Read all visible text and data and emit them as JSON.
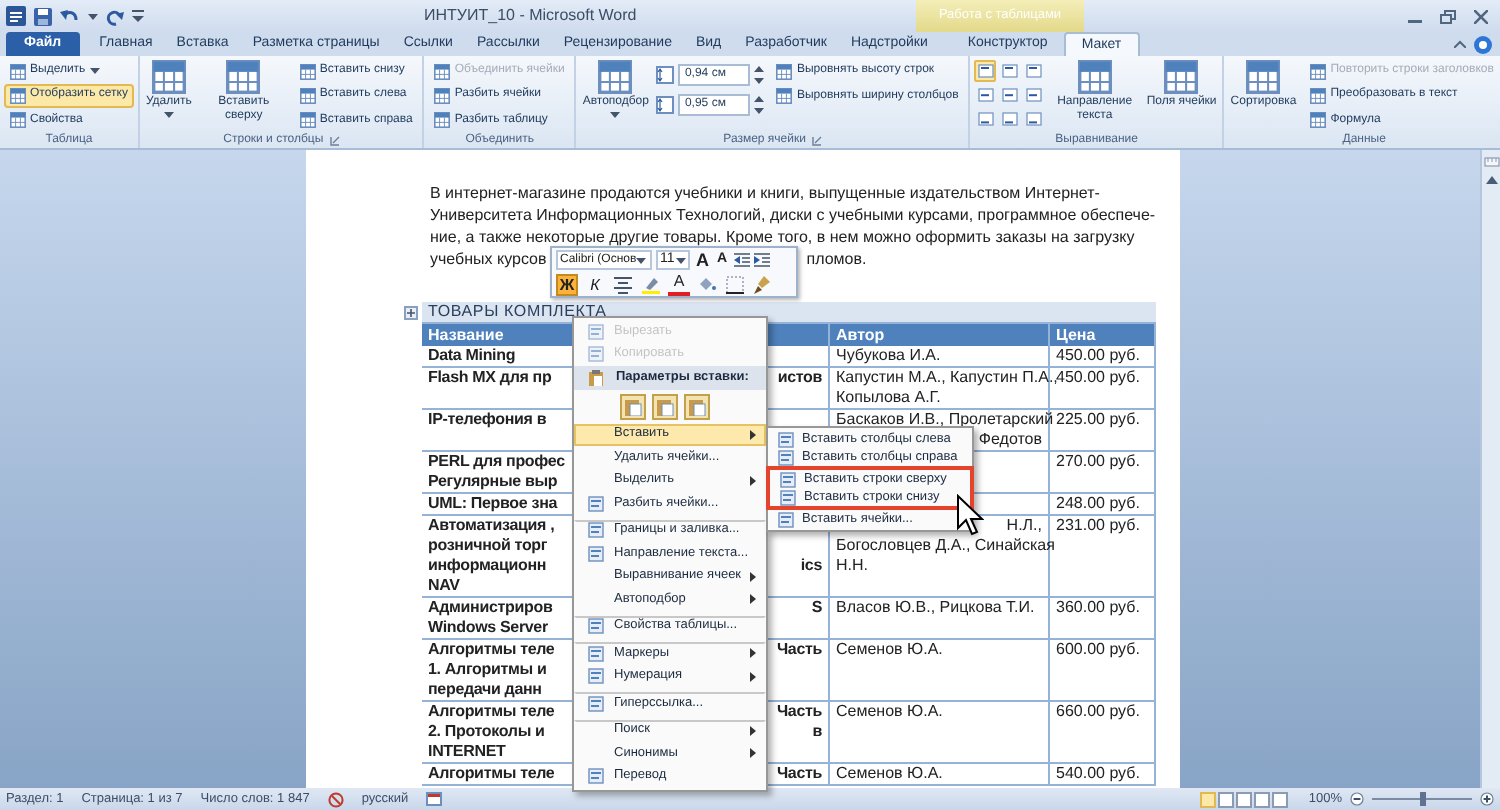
{
  "title_bar": {
    "title": "ИНТУИТ_10 - Microsoft Word",
    "contextual_group": "Работа с таблицами"
  },
  "tabs": [
    {
      "label": "Файл",
      "kind": "file",
      "selected": false
    },
    {
      "label": "Главная",
      "kind": "normal",
      "selected": false
    },
    {
      "label": "Вставка",
      "kind": "normal",
      "selected": false
    },
    {
      "label": "Разметка страницы",
      "kind": "normal",
      "selected": false
    },
    {
      "label": "Ссылки",
      "kind": "normal",
      "selected": false
    },
    {
      "label": "Рассылки",
      "kind": "normal",
      "selected": false
    },
    {
      "label": "Рецензирование",
      "kind": "normal",
      "selected": false
    },
    {
      "label": "Вид",
      "kind": "normal",
      "selected": false
    },
    {
      "label": "Разработчик",
      "kind": "normal",
      "selected": false
    },
    {
      "label": "Надстройки",
      "kind": "normal",
      "selected": false
    },
    {
      "label": "Конструктор",
      "kind": "contextual",
      "selected": false
    },
    {
      "label": "Макет",
      "kind": "contextual",
      "selected": true
    }
  ],
  "ribbon": [
    {
      "label": "Таблица",
      "launcher": false,
      "columns": [
        [
          {
            "kind": "small",
            "label": "Выделить",
            "dropdown": true,
            "on": false,
            "disabled": false
          },
          {
            "kind": "small",
            "label": "Отобразить сетку",
            "dropdown": false,
            "on": true,
            "disabled": false
          },
          {
            "kind": "small",
            "label": "Свойства",
            "dropdown": false,
            "on": false,
            "disabled": false
          }
        ]
      ]
    },
    {
      "label": "Строки и столбцы",
      "launcher": true,
      "columns": [
        [
          {
            "kind": "big",
            "label": "Удалить",
            "dropdown": true,
            "on": false,
            "disabled": false
          }
        ],
        [
          {
            "kind": "big",
            "label": "Вставить сверху",
            "dropdown": false,
            "on": false,
            "disabled": false
          }
        ],
        [
          {
            "kind": "small",
            "label": "Вставить снизу",
            "dropdown": false,
            "on": false,
            "disabled": false
          },
          {
            "kind": "small",
            "label": "Вставить слева",
            "dropdown": false,
            "on": false,
            "disabled": false
          },
          {
            "kind": "small",
            "label": "Вставить справа",
            "dropdown": false,
            "on": false,
            "disabled": false
          }
        ]
      ]
    },
    {
      "label": "Объединить",
      "launcher": false,
      "columns": [
        [
          {
            "kind": "small",
            "label": "Объединить ячейки",
            "dropdown": false,
            "on": false,
            "disabled": true
          },
          {
            "kind": "small",
            "label": "Разбить ячейки",
            "dropdown": false,
            "on": false,
            "disabled": false
          },
          {
            "kind": "small",
            "label": "Разбить таблицу",
            "dropdown": false,
            "on": false,
            "disabled": false
          }
        ]
      ]
    },
    {
      "label": "Размер ячейки",
      "launcher": true,
      "columns": [
        [
          {
            "kind": "big",
            "label": "Автоподбор",
            "dropdown": true,
            "on": false,
            "disabled": false
          }
        ],
        [
          {
            "kind": "spin",
            "value": "0,94 см"
          },
          {
            "kind": "spin",
            "value": "0,95 см"
          }
        ],
        [
          {
            "kind": "small",
            "label": "Выровнять высоту строк",
            "dropdown": false,
            "on": false,
            "disabled": false
          },
          {
            "kind": "small",
            "label": "Выровнять ширину столбцов",
            "dropdown": false,
            "on": false,
            "disabled": false
          }
        ]
      ]
    },
    {
      "label": "Выравнивание",
      "launcher": false,
      "columns": [
        [
          {
            "kind": "align_grid",
            "cells": [
              {
                "selected": true
              },
              {
                "selected": false
              },
              {
                "selected": false
              },
              {
                "selected": false
              },
              {
                "selected": false
              },
              {
                "selected": false
              },
              {
                "selected": false
              },
              {
                "selected": false
              },
              {
                "selected": false
              }
            ]
          }
        ],
        [
          {
            "kind": "big",
            "label": "Направление текста",
            "dropdown": false,
            "on": false,
            "disabled": false
          }
        ],
        [
          {
            "kind": "big",
            "label": "Поля ячейки",
            "dropdown": false,
            "on": false,
            "disabled": false
          }
        ]
      ]
    },
    {
      "label": "Данные",
      "launcher": false,
      "columns": [
        [
          {
            "kind": "big",
            "label": "Сортировка",
            "dropdown": false,
            "on": false,
            "disabled": false
          }
        ],
        [
          {
            "kind": "small",
            "label": "Повторить строки заголовков",
            "dropdown": false,
            "on": false,
            "disabled": true
          },
          {
            "kind": "small",
            "label": "Преобразовать в текст",
            "dropdown": false,
            "on": false,
            "disabled": false
          },
          {
            "kind": "small",
            "label": "Формула",
            "dropdown": false,
            "on": false,
            "disabled": false
          }
        ]
      ]
    }
  ],
  "paragraph": [
    {
      "start": "В интернет-магазине продаются учебники и книги, выпущенные издательством Интернет-"
    },
    {
      "start": "Университета Информационных Технологий, диски с учебными курсами, программное обеспече-"
    },
    {
      "start": "ние, а также некоторые другие товары. Кроме того, в нем можно оформить заказы на загрузку"
    },
    {
      "start": "учебных курсов",
      "end": "пломов."
    }
  ],
  "table": {
    "title": "ТОВАРЫ КОМПЛЕКТА",
    "columns": [
      "Название",
      "Автор",
      "Цена"
    ],
    "rows": [
      {
        "name": [
          {
            "start": "Data Mining"
          }
        ],
        "author": [
          {
            "start": "Чубукова И.А."
          }
        ],
        "price": "450.00 руб."
      },
      {
        "name": [
          {
            "start": "Flash MX для пр",
            "end": "истов"
          }
        ],
        "author": [
          {
            "start": "Капустин М.А., Капустин П.А.,"
          },
          {
            "start": "Копылова А.Г."
          }
        ],
        "price": "450.00 руб."
      },
      {
        "name": [
          {
            "start": "IP-телефония в"
          }
        ],
        "author": [
          {
            "start": "Баскаков И.В., Пролетарский"
          },
          {
            "end": "Федотов"
          }
        ],
        "price": "225.00 руб."
      },
      {
        "name": [
          {
            "start": "PERL для профес"
          },
          {
            "start": "Регулярные выр"
          }
        ],
        "price": "270.00 руб."
      },
      {
        "name": [
          {
            "start": "UML: Первое зна"
          }
        ],
        "price": "248.00 руб."
      },
      {
        "name": [
          {
            "start": "Автоматизация ,"
          },
          {
            "start": "розничной торг"
          },
          {
            "start": "информационн",
            "end": "ics"
          },
          {
            "start": "NAV"
          }
        ],
        "author": [
          {
            "end": "Н.Л.,"
          },
          {
            "start": "Богословцев Д.А., Синайская"
          },
          {
            "start": "Н.Н."
          }
        ],
        "price": "231.00 руб."
      },
      {
        "name": [
          {
            "start": "Администриров",
            "end": "S"
          },
          {
            "start": "Windows Server"
          }
        ],
        "author": [
          {
            "start": "Власов Ю.В., Рицкова Т.И."
          }
        ],
        "price": "360.00 руб."
      },
      {
        "name": [
          {
            "start": "Алгоритмы теле",
            "end": "Часть"
          },
          {
            "start": "1. Алгоритмы и"
          },
          {
            "start": "передачи данн"
          }
        ],
        "author": [
          {
            "start": "Семенов Ю.А."
          }
        ],
        "price": "600.00 руб."
      },
      {
        "name": [
          {
            "start": "Алгоритмы теле",
            "end": "Часть"
          },
          {
            "start": "2. Протоколы и",
            "end": "в"
          },
          {
            "start": "INTERNET"
          }
        ],
        "author": [
          {
            "start": "Семенов Ю.А."
          }
        ],
        "price": "660.00 руб."
      },
      {
        "name": [
          {
            "start": "Алгоритмы теле",
            "end": "Часть"
          }
        ],
        "author": [
          {
            "start": "Семенов Ю.А."
          }
        ],
        "price": "540.00 руб."
      }
    ]
  },
  "mini_toolbar": {
    "font": "Calibri (Основ",
    "size": "11",
    "grow": "A",
    "shrink": "A",
    "buttons": [
      {
        "kind": "bold",
        "label": "Ж",
        "on": true
      },
      {
        "kind": "italic",
        "label": "К",
        "on": false
      },
      {
        "kind": "center",
        "on": false
      },
      {
        "kind": "highlight",
        "on": false
      },
      {
        "kind": "font_color",
        "label": "A",
        "on": false
      },
      {
        "kind": "shading",
        "on": false
      },
      {
        "kind": "borders",
        "on": false
      },
      {
        "kind": "format_painter",
        "on": false
      }
    ]
  },
  "context_menu": [
    {
      "kind": "icon",
      "label": "Вырезать",
      "disabled": true,
      "selected": false,
      "submenu": false,
      "separator": false
    },
    {
      "kind": "icon",
      "label": "Копировать",
      "disabled": true,
      "selected": false,
      "submenu": false,
      "separator": false
    },
    {
      "kind": "header",
      "label": "Параметры вставки:",
      "disabled": false,
      "selected": false,
      "submenu": false,
      "separator": false
    },
    {
      "kind": "paste_options",
      "disabled": false,
      "selected": false,
      "submenu": false,
      "separator": false
    },
    {
      "kind": "plain",
      "label": "Вставить",
      "disabled": false,
      "selected": true,
      "submenu": true,
      "separator": false
    },
    {
      "kind": "plain",
      "label": "Удалить ячейки...",
      "disabled": false,
      "selected": false,
      "submenu": false,
      "separator": false
    },
    {
      "kind": "plain",
      "label": "Выделить",
      "disabled": false,
      "selected": false,
      "submenu": true,
      "separator": false
    },
    {
      "kind": "icon",
      "label": "Разбить ячейки...",
      "disabled": false,
      "selected": false,
      "submenu": false,
      "separator": false
    },
    {
      "kind": "icon",
      "label": "Границы и заливка...",
      "disabled": false,
      "selected": false,
      "submenu": false,
      "separator": true
    },
    {
      "kind": "icon",
      "label": "Направление текста...",
      "disabled": false,
      "selected": false,
      "submenu": false,
      "separator": false
    },
    {
      "kind": "plain",
      "label": "Выравнивание ячеек",
      "disabled": false,
      "selected": false,
      "submenu": true,
      "separator": false
    },
    {
      "kind": "plain",
      "label": "Автоподбор",
      "disabled": false,
      "selected": false,
      "submenu": true,
      "separator": false
    },
    {
      "kind": "icon",
      "label": "Свойства таблицы...",
      "disabled": false,
      "selected": false,
      "submenu": false,
      "separator": true
    },
    {
      "kind": "icon",
      "label": "Маркеры",
      "disabled": false,
      "selected": false,
      "submenu": true,
      "separator": true
    },
    {
      "kind": "icon",
      "label": "Нумерация",
      "disabled": false,
      "selected": false,
      "submenu": true,
      "separator": false
    },
    {
      "kind": "icon",
      "label": "Гиперссылка...",
      "disabled": false,
      "selected": false,
      "submenu": false,
      "separator": true
    },
    {
      "kind": "plain",
      "label": "Поиск",
      "disabled": false,
      "selected": false,
      "submenu": true,
      "separator": true
    },
    {
      "kind": "plain",
      "label": "Синонимы",
      "disabled": false,
      "selected": false,
      "submenu": true,
      "separator": false
    },
    {
      "kind": "icon",
      "label": "Перевод",
      "disabled": false,
      "selected": false,
      "submenu": false,
      "separator": false
    }
  ],
  "submenu": [
    {
      "label": "Вставить столбцы слева",
      "framed": false
    },
    {
      "label": "Вставить столбцы справа",
      "framed": false
    },
    {
      "label": "Вставить строки сверху",
      "framed": true
    },
    {
      "label": "Вставить строки снизу",
      "framed": true
    },
    {
      "label": "Вставить ячейки...",
      "framed": false
    }
  ],
  "status_bar": {
    "items": [
      {
        "kind": "text",
        "label": "Раздел: 1"
      },
      {
        "kind": "text",
        "label": "Страница: 1 из 7"
      },
      {
        "kind": "text",
        "label": "Число слов: 1 847"
      },
      {
        "kind": "language",
        "label": "русский"
      }
    ],
    "zoom": "100%",
    "zoom_slider": {
      "level": 0.5
    }
  }
}
